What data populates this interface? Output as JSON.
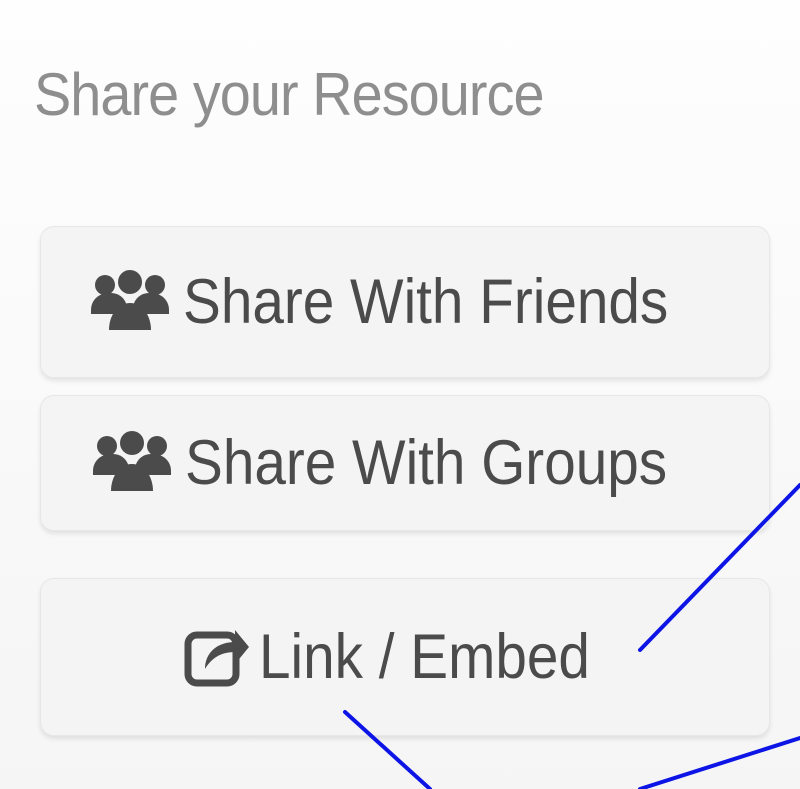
{
  "panel": {
    "title": "Share your Resource"
  },
  "actions": [
    {
      "label": "Share With Friends",
      "icon": "users-icon"
    },
    {
      "label": "Share With Groups",
      "icon": "users-icon"
    },
    {
      "label": "Link / Embed",
      "icon": "share-square-icon"
    }
  ],
  "colors": {
    "title_text": "#8e8e8e",
    "button_text": "#4b4b4b",
    "button_background": "#f4f4f4",
    "annotation_blue": "#0d14e6"
  }
}
